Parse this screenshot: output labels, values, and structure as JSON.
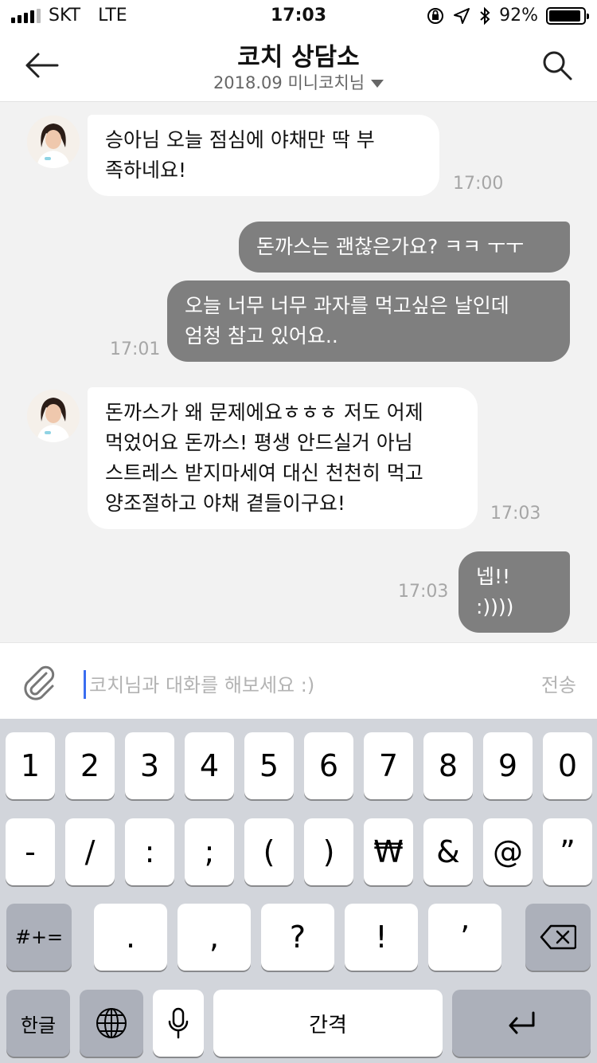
{
  "status_bar": {
    "carrier": "SKT",
    "network": "LTE",
    "time": "17:03",
    "battery": "92%",
    "battery_level": 0.92
  },
  "header": {
    "title": "코치 상담소",
    "subtitle": "2018.09 미니코치님"
  },
  "messages": [
    {
      "sender": "coach",
      "text": "승아님 오늘 점심에 야채만 딱 부\n족하네요!",
      "time": "17:00"
    },
    {
      "sender": "me",
      "text": "돈까스는 괜찮은가요? ㅋㅋ ㅜㅜ",
      "time": ""
    },
    {
      "sender": "me",
      "text": "오늘 너무 너무 과자를 먹고싶은 날인데\n엄청 참고 있어요..",
      "time": "17:01"
    },
    {
      "sender": "coach",
      "text": "돈까스가 왜 문제에요ㅎㅎㅎ 저도 어제\n먹었어요 돈까스! 평생 안드실거 아님\n스트레스 받지마세여 대신 천천히 먹고\n양조절하고 야채 곁들이구요!",
      "time": "17:03"
    },
    {
      "sender": "me",
      "text": "넵!! :))))",
      "time": "17:03"
    }
  ],
  "input": {
    "placeholder": "코치님과 대화를 해보세요 :)",
    "send_label": "전송"
  },
  "keyboard": {
    "row1": [
      "1",
      "2",
      "3",
      "4",
      "5",
      "6",
      "7",
      "8",
      "9",
      "0"
    ],
    "row2": [
      "-",
      "/",
      ":",
      ";",
      "(",
      ")",
      "₩",
      "&",
      "@",
      "”"
    ],
    "row3_left": "#+=",
    "row3": [
      ".",
      ",",
      "?",
      "!",
      "’"
    ],
    "lang_label": "한글",
    "space_label": "간격"
  }
}
